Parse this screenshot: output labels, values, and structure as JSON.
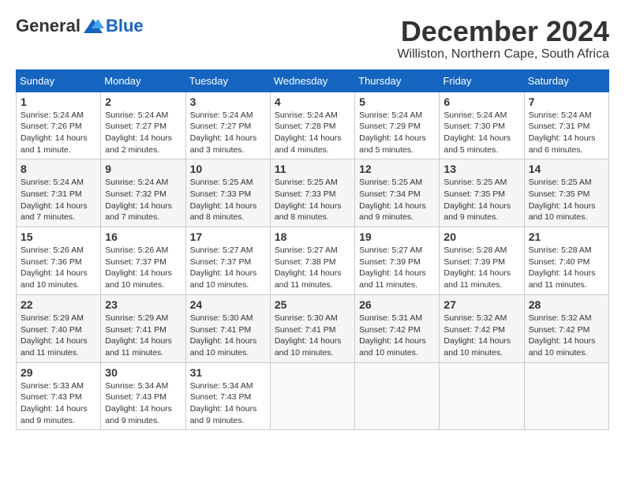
{
  "logo": {
    "general": "General",
    "blue": "Blue"
  },
  "title": {
    "month": "December 2024",
    "location": "Williston, Northern Cape, South Africa"
  },
  "headers": [
    "Sunday",
    "Monday",
    "Tuesday",
    "Wednesday",
    "Thursday",
    "Friday",
    "Saturday"
  ],
  "weeks": [
    [
      {
        "day": "1",
        "sunrise": "5:24 AM",
        "sunset": "7:26 PM",
        "daylight": "14 hours and 1 minute."
      },
      {
        "day": "2",
        "sunrise": "5:24 AM",
        "sunset": "7:27 PM",
        "daylight": "14 hours and 2 minutes."
      },
      {
        "day": "3",
        "sunrise": "5:24 AM",
        "sunset": "7:27 PM",
        "daylight": "14 hours and 3 minutes."
      },
      {
        "day": "4",
        "sunrise": "5:24 AM",
        "sunset": "7:28 PM",
        "daylight": "14 hours and 4 minutes."
      },
      {
        "day": "5",
        "sunrise": "5:24 AM",
        "sunset": "7:29 PM",
        "daylight": "14 hours and 5 minutes."
      },
      {
        "day": "6",
        "sunrise": "5:24 AM",
        "sunset": "7:30 PM",
        "daylight": "14 hours and 5 minutes."
      },
      {
        "day": "7",
        "sunrise": "5:24 AM",
        "sunset": "7:31 PM",
        "daylight": "14 hours and 6 minutes."
      }
    ],
    [
      {
        "day": "8",
        "sunrise": "5:24 AM",
        "sunset": "7:31 PM",
        "daylight": "14 hours and 7 minutes."
      },
      {
        "day": "9",
        "sunrise": "5:24 AM",
        "sunset": "7:32 PM",
        "daylight": "14 hours and 7 minutes."
      },
      {
        "day": "10",
        "sunrise": "5:25 AM",
        "sunset": "7:33 PM",
        "daylight": "14 hours and 8 minutes."
      },
      {
        "day": "11",
        "sunrise": "5:25 AM",
        "sunset": "7:33 PM",
        "daylight": "14 hours and 8 minutes."
      },
      {
        "day": "12",
        "sunrise": "5:25 AM",
        "sunset": "7:34 PM",
        "daylight": "14 hours and 9 minutes."
      },
      {
        "day": "13",
        "sunrise": "5:25 AM",
        "sunset": "7:35 PM",
        "daylight": "14 hours and 9 minutes."
      },
      {
        "day": "14",
        "sunrise": "5:25 AM",
        "sunset": "7:35 PM",
        "daylight": "14 hours and 10 minutes."
      }
    ],
    [
      {
        "day": "15",
        "sunrise": "5:26 AM",
        "sunset": "7:36 PM",
        "daylight": "14 hours and 10 minutes."
      },
      {
        "day": "16",
        "sunrise": "5:26 AM",
        "sunset": "7:37 PM",
        "daylight": "14 hours and 10 minutes."
      },
      {
        "day": "17",
        "sunrise": "5:27 AM",
        "sunset": "7:37 PM",
        "daylight": "14 hours and 10 minutes."
      },
      {
        "day": "18",
        "sunrise": "5:27 AM",
        "sunset": "7:38 PM",
        "daylight": "14 hours and 11 minutes."
      },
      {
        "day": "19",
        "sunrise": "5:27 AM",
        "sunset": "7:39 PM",
        "daylight": "14 hours and 11 minutes."
      },
      {
        "day": "20",
        "sunrise": "5:28 AM",
        "sunset": "7:39 PM",
        "daylight": "14 hours and 11 minutes."
      },
      {
        "day": "21",
        "sunrise": "5:28 AM",
        "sunset": "7:40 PM",
        "daylight": "14 hours and 11 minutes."
      }
    ],
    [
      {
        "day": "22",
        "sunrise": "5:29 AM",
        "sunset": "7:40 PM",
        "daylight": "14 hours and 11 minutes."
      },
      {
        "day": "23",
        "sunrise": "5:29 AM",
        "sunset": "7:41 PM",
        "daylight": "14 hours and 11 minutes."
      },
      {
        "day": "24",
        "sunrise": "5:30 AM",
        "sunset": "7:41 PM",
        "daylight": "14 hours and 10 minutes."
      },
      {
        "day": "25",
        "sunrise": "5:30 AM",
        "sunset": "7:41 PM",
        "daylight": "14 hours and 10 minutes."
      },
      {
        "day": "26",
        "sunrise": "5:31 AM",
        "sunset": "7:42 PM",
        "daylight": "14 hours and 10 minutes."
      },
      {
        "day": "27",
        "sunrise": "5:32 AM",
        "sunset": "7:42 PM",
        "daylight": "14 hours and 10 minutes."
      },
      {
        "day": "28",
        "sunrise": "5:32 AM",
        "sunset": "7:42 PM",
        "daylight": "14 hours and 10 minutes."
      }
    ],
    [
      {
        "day": "29",
        "sunrise": "5:33 AM",
        "sunset": "7:43 PM",
        "daylight": "14 hours and 9 minutes."
      },
      {
        "day": "30",
        "sunrise": "5:34 AM",
        "sunset": "7:43 PM",
        "daylight": "14 hours and 9 minutes."
      },
      {
        "day": "31",
        "sunrise": "5:34 AM",
        "sunset": "7:43 PM",
        "daylight": "14 hours and 9 minutes."
      },
      null,
      null,
      null,
      null
    ]
  ],
  "labels": {
    "sunrise": "Sunrise:",
    "sunset": "Sunset:",
    "daylight": "Daylight:"
  }
}
